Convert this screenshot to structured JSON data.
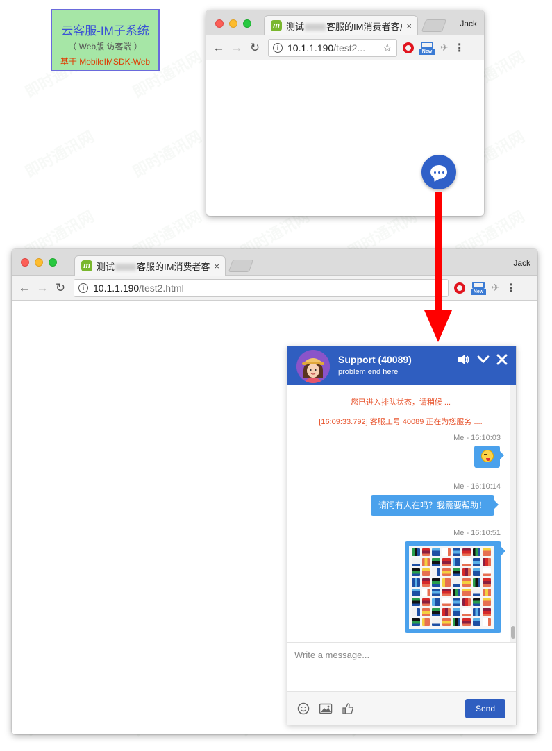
{
  "label_box": {
    "title": "云客服-IM子系统",
    "subtitle": "（ Web版 访客端 ）",
    "basis": "基于 MobileIMSDK-Web"
  },
  "browser": {
    "tab_title_prefix": "测试",
    "tab_title_suffix": "客服的IM消费者客户",
    "favicon_letter": "m",
    "close_glyph": "×",
    "user_name": "Jack",
    "url_host": "10.1.1.190",
    "url_path_full": "/test2.html",
    "url_path_truncated": "/test2...",
    "extension_new_label": "New"
  },
  "chat": {
    "agent_name": "Support (40089)",
    "status_text": "problem end here",
    "system_messages": [
      "您已进入排队状态，请稍候 ...",
      "[16:09:33.792] 客服工号 40089 正在为您服务 ...."
    ],
    "messages": [
      {
        "meta": "Me - 16:10:03",
        "type": "emoji"
      },
      {
        "meta": "Me - 16:10:14",
        "type": "text",
        "text": "请问有人在吗？我需要帮助！"
      },
      {
        "meta": "Me - 16:10:51",
        "type": "image"
      }
    ],
    "input_placeholder": "Write a message...",
    "send_label": "Send"
  },
  "colors": {
    "brand": "#2f5ec0",
    "bubble": "#4aa1ec",
    "system_text": "#e8542d",
    "arrow": "#ff0000"
  },
  "watermark": "即时通讯网"
}
